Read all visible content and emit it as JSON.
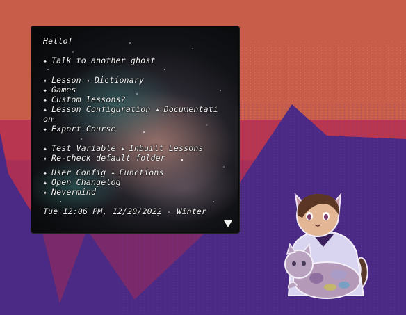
{
  "balloon": {
    "greeting": "Hello!",
    "talk": "Talk to another ghost",
    "row1": {
      "a": "Lesson",
      "b": "Dictionary"
    },
    "games": "Games",
    "custom": "Custom lessons?",
    "row2": {
      "a": "Lesson Configuration",
      "b": "Documentati"
    },
    "row2_wrap": "on",
    "export": "Export Course",
    "row3": {
      "a": "Test Variable",
      "b": "Inbuilt Lessons"
    },
    "recheck": "Re-check default folder",
    "row4": {
      "a": "User Config",
      "b": "Functions"
    },
    "changelog": "Open Changelog",
    "nevermind": "Nevermind",
    "timestamp": "Tue 12:06 PM, 12/20/2022 - Winter",
    "star_glyph": "✦"
  },
  "colors": {
    "sky": "#c85e4a",
    "horizon": "#b8364f",
    "mountains": "#4a2a84",
    "text": "#f4f4f4"
  },
  "icons": {
    "scroll": "down-triangle-icon"
  }
}
